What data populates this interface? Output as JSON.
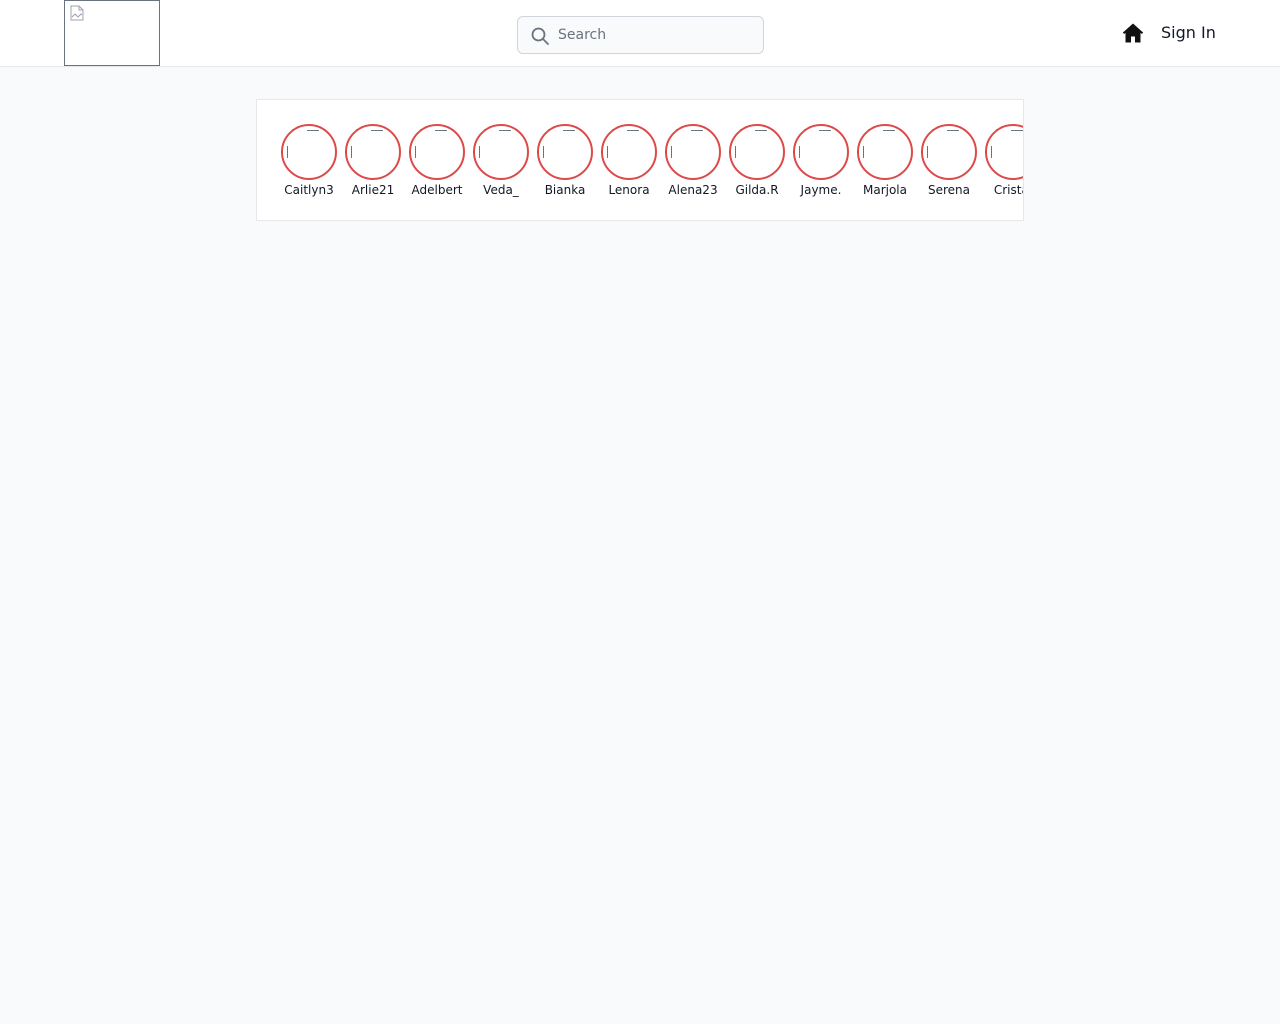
{
  "header": {
    "search_placeholder": "Search",
    "search_value": "",
    "signin_label": "Sign In"
  },
  "stories": [
    {
      "username": "Caitlyn3"
    },
    {
      "username": "Arlie21"
    },
    {
      "username": "Adelbert"
    },
    {
      "username": "Veda_"
    },
    {
      "username": "Bianka"
    },
    {
      "username": "Lenora"
    },
    {
      "username": "Alena23"
    },
    {
      "username": "Gilda.R"
    },
    {
      "username": "Jayme."
    },
    {
      "username": "Marjola"
    },
    {
      "username": "Serena"
    },
    {
      "username": "Cristal"
    }
  ],
  "colors": {
    "story_ring": "#dc4a4a",
    "page_bg": "#f9fafb",
    "border": "#e5e7eb"
  }
}
